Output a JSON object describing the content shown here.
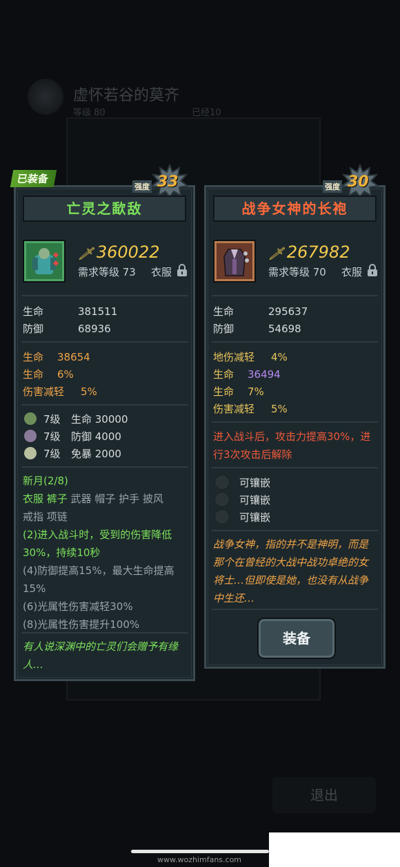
{
  "background": {
    "title": "虚怀若谷的莫齐",
    "level": "等级 80",
    "sub2": "已经10",
    "exit_label": "退出"
  },
  "left_card": {
    "equipped_tag": "已装备",
    "strength_label": "强度",
    "strength": "33",
    "name": "亡灵之歃敌",
    "power": "360022",
    "required_level": "需求等级 73",
    "slot": "衣服",
    "base_stats": [
      {
        "name": "生命",
        "value": "381511"
      },
      {
        "name": "防御",
        "value": "68936"
      }
    ],
    "bonus_stats": [
      {
        "name": "生命",
        "value": "38654"
      },
      {
        "name": "生命",
        "value": "6%"
      },
      {
        "name": "伤害减轻",
        "value": "5%"
      }
    ],
    "gems": [
      {
        "level": "7级",
        "text": "生命 30000",
        "color": "#6e8f5a"
      },
      {
        "level": "7级",
        "text": "防御 4000",
        "color": "#8a7a9a"
      },
      {
        "level": "7级",
        "text": "免暴 2000",
        "color": "#b8c0a0"
      }
    ],
    "set_name": "新月(2/8)",
    "set_pieces_active": "衣服 裤子",
    "set_pieces_inactive": " 武器 帽子 护手 披风",
    "set_pieces_line2": "戒指 项链",
    "set_bonus_active": "(2)进入战斗时，受到的伤害降低30%，持续10秒",
    "set_bonus_4": "(4)防御提高15%，最大生命提高15%",
    "set_bonus_6": "(6)光属性伤害减轻30%",
    "set_bonus_8": "(8)光属性伤害提升100%",
    "flavor": "有人说深渊中的亡灵们会赠予有缘人…"
  },
  "right_card": {
    "strength_label": "强度",
    "strength": "30",
    "name": "战争女神的长袍",
    "power": "267982",
    "required_level": "需求等级 70",
    "slot": "衣服",
    "base_stats": [
      {
        "name": "生命",
        "value": "295637"
      },
      {
        "name": "防御",
        "value": "54698"
      }
    ],
    "bonus_stats": [
      {
        "name": "地伤减轻",
        "value": "4%"
      },
      {
        "name": "生命",
        "value": "36494"
      },
      {
        "name": "生命",
        "value": "7%"
      },
      {
        "name": "伤害减轻",
        "value": "5%"
      }
    ],
    "special_effect": "进入战斗后，攻击力提高30%，进行3次攻击后解除",
    "sockets": [
      "可镶嵌",
      "可镶嵌",
      "可镶嵌"
    ],
    "flavor": "战争女神，指的并不是神明，而是那个在曾经的大战中战功卓绝的女将士…但即使是她，也没有从战争中生还…",
    "equip_label": "装备"
  },
  "watermark": "www.wozhimfans.com"
}
